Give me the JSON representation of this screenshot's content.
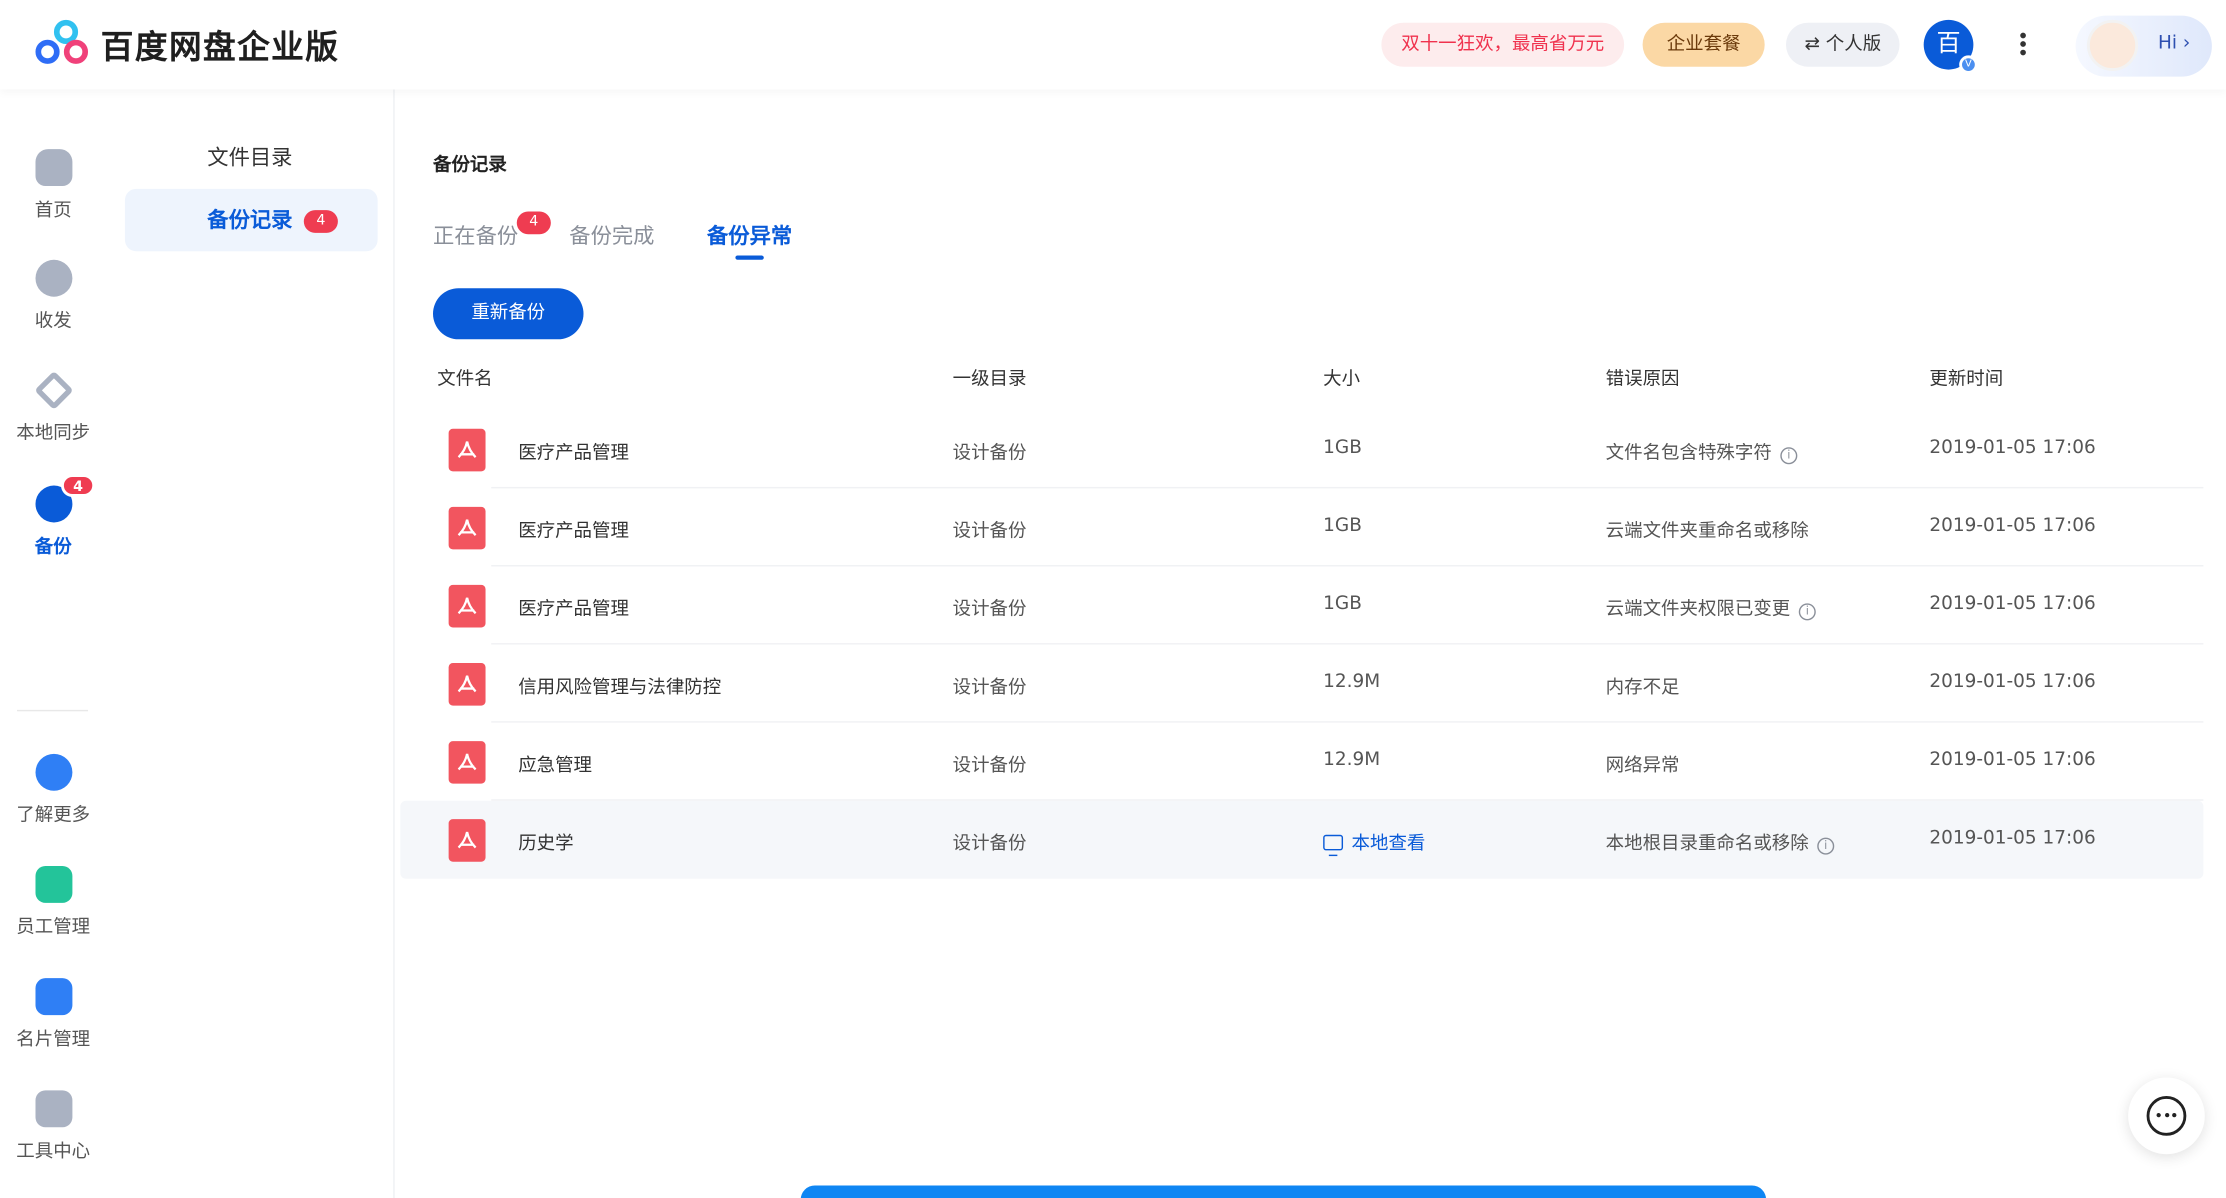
{
  "app": {
    "title": "百度网盘企业版"
  },
  "header": {
    "promo": "双十一狂欢，最高省万元",
    "package": "企业套餐",
    "personal": "个人版",
    "avatar_char": "百",
    "avatar_badge": "V",
    "hi": "Hi ›"
  },
  "rail": {
    "home": "首页",
    "transfer": "收发",
    "sync": "本地同步",
    "backup": "备份",
    "backup_badge": "4",
    "more": "了解更多",
    "staff": "员工管理",
    "cards": "名片管理",
    "tools": "工具中心"
  },
  "subnav": {
    "directory": "文件目录",
    "records": "备份记录",
    "records_badge": "4"
  },
  "page": {
    "title": "备份记录",
    "tabs": [
      {
        "label": "正在备份",
        "badge": "4"
      },
      {
        "label": "备份完成"
      },
      {
        "label": "备份异常"
      }
    ],
    "rebackup_button": "重新备份"
  },
  "table": {
    "headers": [
      "文件名",
      "一级目录",
      "大小",
      "错误原因",
      "更新时间"
    ],
    "rows": [
      {
        "name": "医疗产品管理",
        "dir": "设计备份",
        "size": "1GB",
        "reason": "文件名包含特殊字符",
        "info": true,
        "time": "2019-01-05 17:06"
      },
      {
        "name": "医疗产品管理",
        "dir": "设计备份",
        "size": "1GB",
        "reason": "云端文件夹重命名或移除",
        "info": false,
        "time": "2019-01-05 17:06"
      },
      {
        "name": "医疗产品管理",
        "dir": "设计备份",
        "size": "1GB",
        "reason": "云端文件夹权限已变更",
        "info": true,
        "time": "2019-01-05 17:06"
      },
      {
        "name": "信用风险管理与法律防控",
        "dir": "设计备份",
        "size": "12.9M",
        "reason": "内存不足",
        "info": false,
        "time": "2019-01-05 17:06"
      },
      {
        "name": "应急管理",
        "dir": "设计备份",
        "size": "12.9M",
        "reason": "网络异常",
        "info": false,
        "time": "2019-01-05 17:06"
      },
      {
        "name": "历史学",
        "dir": "设计备份",
        "size": "本地查看",
        "reason": "本地根目录重命名或移除",
        "info": true,
        "time": "2019-01-05 17:06"
      }
    ]
  },
  "icons": {
    "info": "i"
  },
  "colors": {
    "accent": "#0a5bd8",
    "badge": "#ef3c51",
    "pdf": "#f2555f"
  }
}
